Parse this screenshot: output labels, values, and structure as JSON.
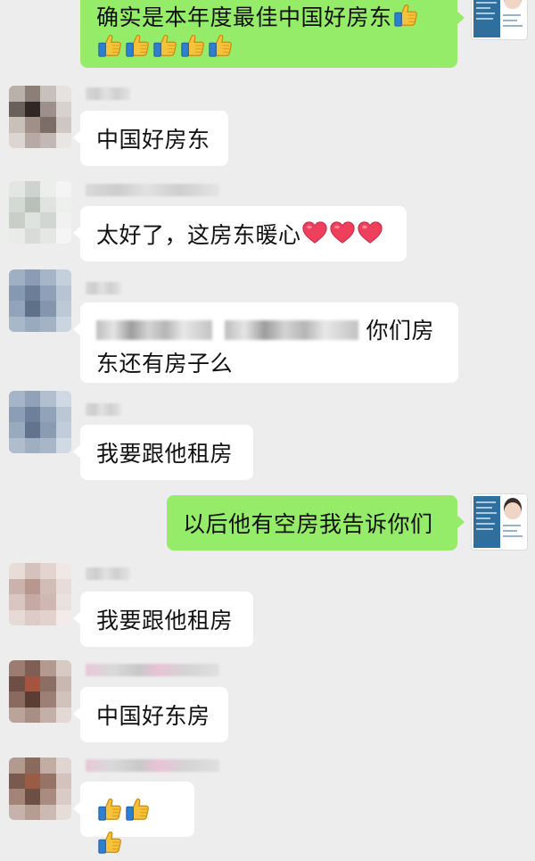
{
  "chat": {
    "messages": [
      {
        "sender": "me",
        "text": "确实是本年度最佳中国好房东",
        "emojis_inline": [
          "thumbs-up-icon"
        ],
        "emojis_second_line": [
          "thumbs-up-icon",
          "thumbs-up-icon",
          "thumbs-up-icon",
          "thumbs-up-icon",
          "thumbs-up-icon"
        ]
      },
      {
        "sender": "other",
        "text": "中国好房东"
      },
      {
        "sender": "other",
        "text": "太好了，这房东暖心",
        "emojis": [
          "heart-icon",
          "heart-icon",
          "heart-icon"
        ]
      },
      {
        "sender": "other",
        "text_line1": "你们房",
        "text_line2": "东还有房子么"
      },
      {
        "sender": "other",
        "text": "我要跟他租房"
      },
      {
        "sender": "me",
        "text": "以后他有空房我告诉你们"
      },
      {
        "sender": "other",
        "text": "我要跟他租房"
      },
      {
        "sender": "other",
        "text": "中国好东房"
      },
      {
        "sender": "other",
        "emojis": [
          "thumbs-up-icon",
          "thumbs-up-icon",
          "thumbs-up-icon"
        ]
      }
    ]
  },
  "colors": {
    "background": "#ededed",
    "outgoing_bubble": "#95ec69",
    "incoming_bubble": "#ffffff"
  }
}
